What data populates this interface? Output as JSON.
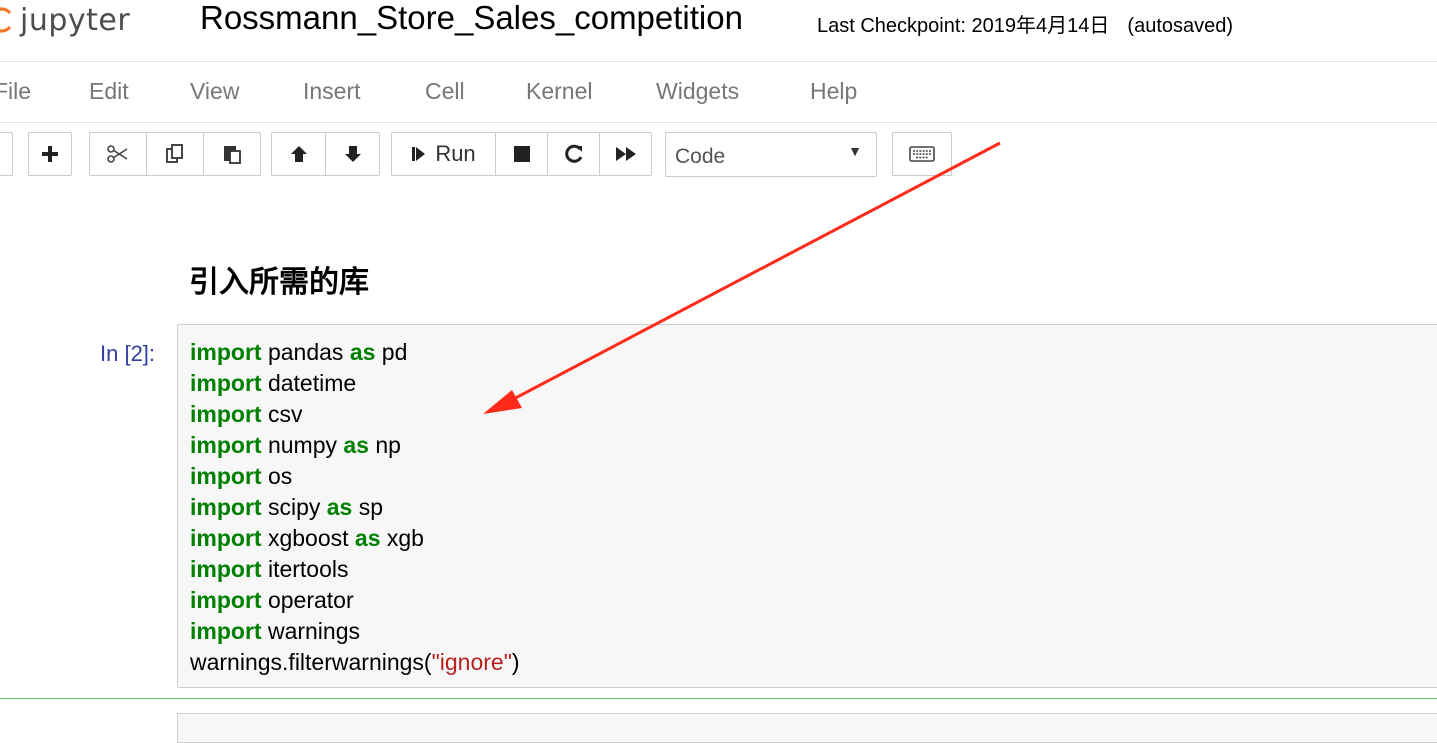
{
  "header": {
    "logo_text": "jupyter",
    "notebook_name": "Rossmann_Store_Sales_competition",
    "checkpoint_text": "Last Checkpoint: 2019年4月14日",
    "autosave_text": "(autosaved)"
  },
  "menubar": {
    "items": [
      "File",
      "Edit",
      "View",
      "Insert",
      "Cell",
      "Kernel",
      "Widgets",
      "Help"
    ]
  },
  "toolbar": {
    "run_label": "Run",
    "cell_type": "Code",
    "icons": [
      "save-icon",
      "plus-icon",
      "cut-icon",
      "copy-icon",
      "paste-icon",
      "arrow-up-icon",
      "arrow-down-icon",
      "step-forward-icon",
      "stop-icon",
      "restart-icon",
      "fast-forward-icon",
      "keyboard-icon"
    ]
  },
  "notebook": {
    "markdown_heading": "引入所需的库",
    "prompt": "In [2]:",
    "code_lines": [
      [
        {
          "t": "import",
          "k": "kw"
        },
        {
          "t": " pandas "
        },
        {
          "t": "as",
          "k": "kw"
        },
        {
          "t": " pd"
        }
      ],
      [
        {
          "t": "import",
          "k": "kw"
        },
        {
          "t": " datetime"
        }
      ],
      [
        {
          "t": "import",
          "k": "kw"
        },
        {
          "t": " csv"
        }
      ],
      [
        {
          "t": "import",
          "k": "kw"
        },
        {
          "t": " numpy "
        },
        {
          "t": "as",
          "k": "kw"
        },
        {
          "t": " np"
        }
      ],
      [
        {
          "t": "import",
          "k": "kw"
        },
        {
          "t": " os"
        }
      ],
      [
        {
          "t": "import",
          "k": "kw"
        },
        {
          "t": " scipy "
        },
        {
          "t": "as",
          "k": "kw"
        },
        {
          "t": " sp"
        }
      ],
      [
        {
          "t": "import",
          "k": "kw"
        },
        {
          "t": " xgboost "
        },
        {
          "t": "as",
          "k": "kw"
        },
        {
          "t": " xgb"
        }
      ],
      [
        {
          "t": "import",
          "k": "kw"
        },
        {
          "t": " itertools"
        }
      ],
      [
        {
          "t": "import",
          "k": "kw"
        },
        {
          "t": " operator"
        }
      ],
      [
        {
          "t": "import",
          "k": "kw"
        },
        {
          "t": " warnings"
        }
      ],
      [
        {
          "t": "warnings.filterwarnings("
        },
        {
          "t": "\"ignore\"",
          "k": "str"
        },
        {
          "t": ")"
        }
      ]
    ]
  },
  "colors": {
    "keyword": "#008000",
    "string": "#ba2121",
    "prompt": "#303f9f",
    "annotation_arrow": "#ff2a1a",
    "selected_cell_border": "#66bb6a"
  }
}
